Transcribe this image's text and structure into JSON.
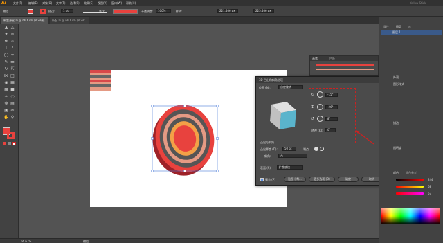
{
  "app": {
    "logo": "Ai",
    "user": "Yellow Stick"
  },
  "menu": [
    "文件(F)",
    "编辑(E)",
    "对象(O)",
    "文字(T)",
    "选择(S)",
    "效果(C)",
    "视图(V)",
    "窗口(W)",
    "帮助(H)"
  ],
  "control_bar": {
    "selection_label": "编组",
    "stroke_label": "描边:",
    "stroke_value": "1 pt",
    "brush_label": "等比",
    "style_label": "不透明度:",
    "opacity_value": "100%",
    "style_name": "样式:",
    "x_value": "221.406 px",
    "y_value": "225.406 px"
  },
  "tabs": [
    {
      "label": "新起源宣.ai @ 66.67% (RGB/预览)",
      "active": true
    },
    {
      "label": "新起.ai @ 66.67% (RGB/预览)",
      "active": false
    }
  ],
  "status": {
    "zoom": "66.67%",
    "info": "编组"
  },
  "swatch_panel": {
    "tabs": [
      "画笔",
      "色板"
    ]
  },
  "dialog": {
    "title": "3D 凸出和斜角选项",
    "position_label": "位置 (N):",
    "position_value": "自定旋转",
    "x_angle": "-15°",
    "y_angle": "-26°",
    "z_angle": "8°",
    "perspective_label": "透视 (R):",
    "perspective_value": "0°",
    "extrude_section": "凸出与斜角",
    "depth_label": "凸出厚度 (D):",
    "depth_value": "50 pt",
    "cap_label": "端点:",
    "bevel_label": "斜角:",
    "bevel_value": "无",
    "surface_label": "表面 (S):",
    "surface_value": "扩散底纹",
    "preview_label": "预览 (P)",
    "map_button": "贴图 (M)...",
    "more_button": "更多选项 (O)",
    "ok_button": "确定",
    "cancel_button": "取消"
  },
  "right_panel": {
    "tabs": [
      "属性",
      "图层",
      "库"
    ],
    "layer_name": "图层 1",
    "sections": [
      "外观",
      "图形样式",
      "描边",
      "透明度",
      "颜色",
      "颜色参考"
    ],
    "color_values": [
      "244",
      "68",
      "67"
    ]
  },
  "colors": {
    "fill": "#e8423e",
    "accent": "#ff9a00",
    "target_circle": "#cc2222"
  }
}
